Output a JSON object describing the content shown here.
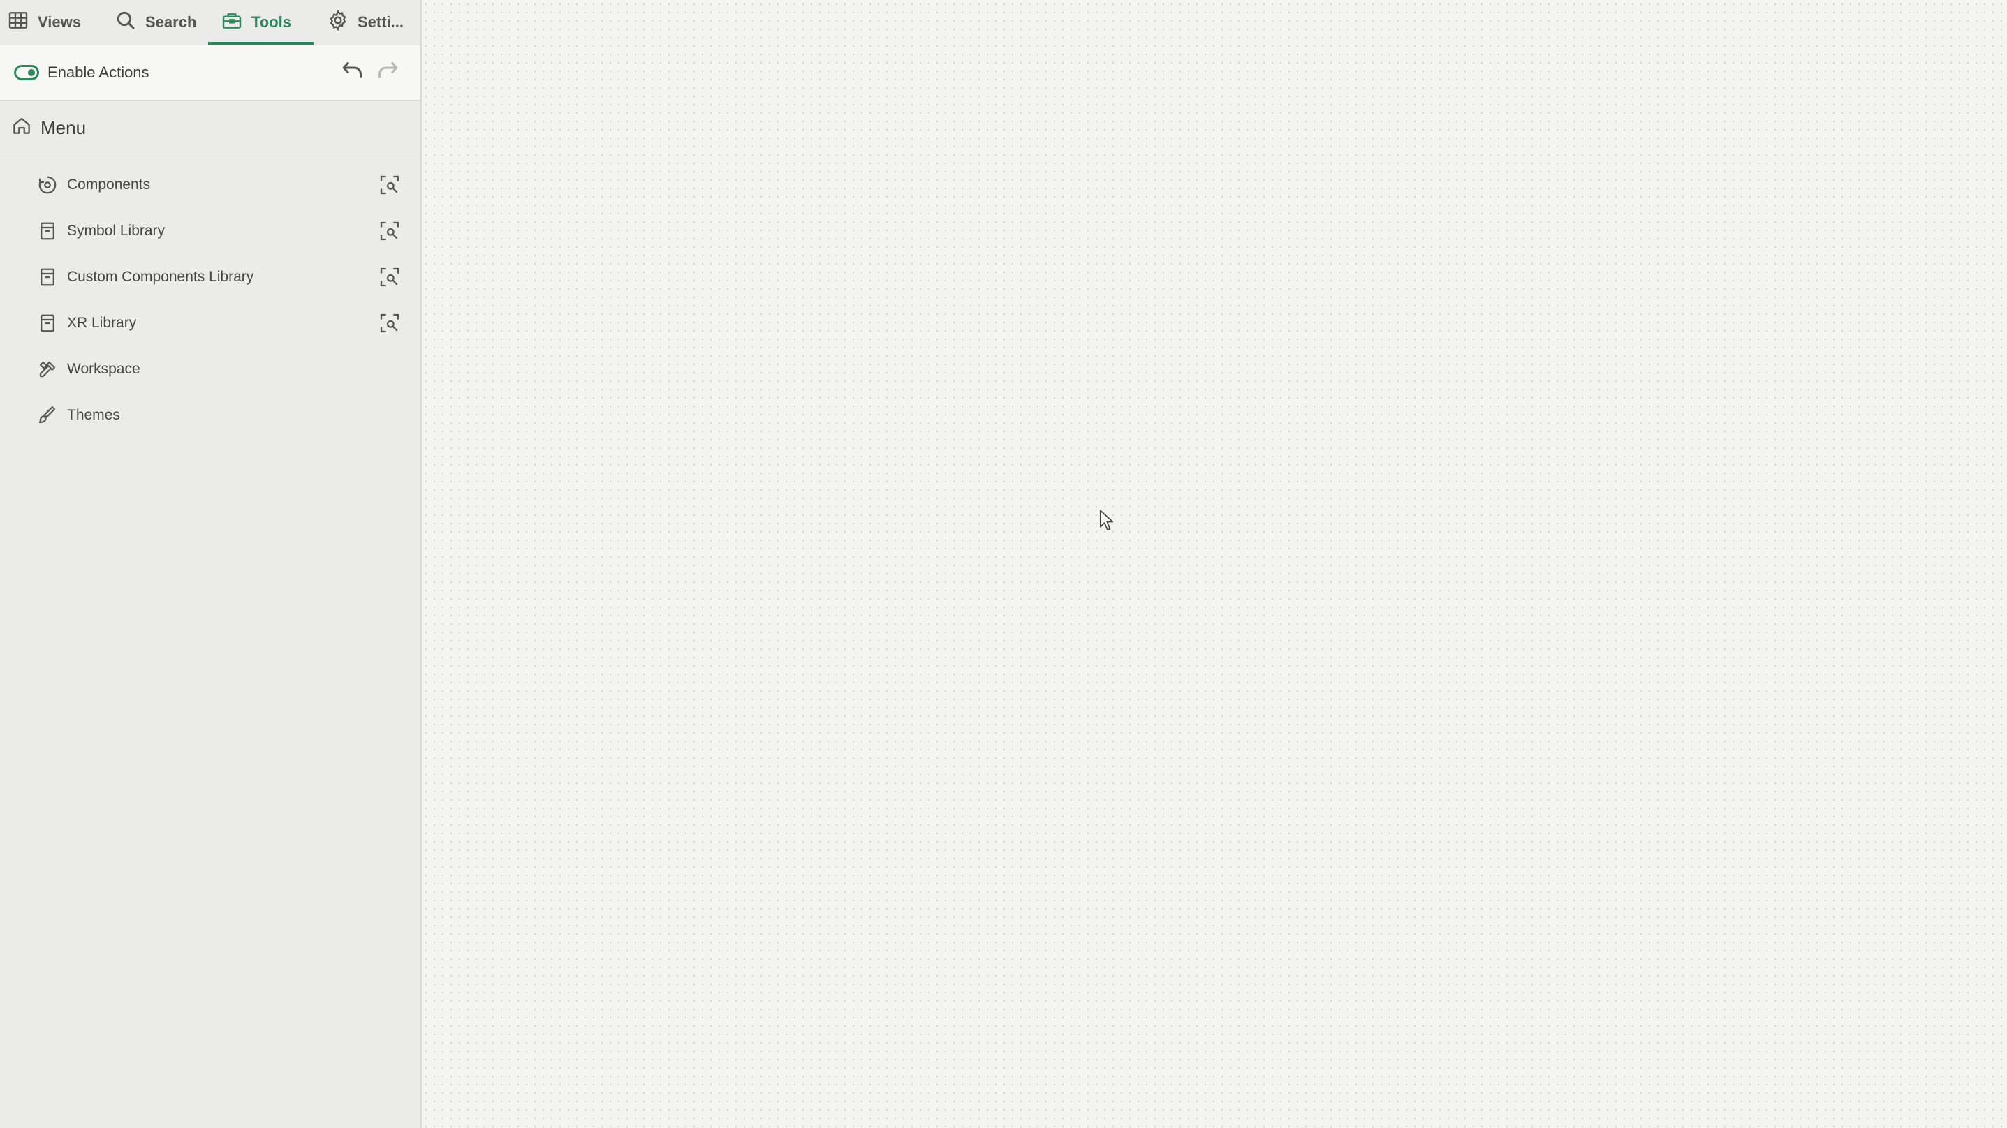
{
  "tabs": [
    {
      "label": "Views",
      "icon": "grid-icon"
    },
    {
      "label": "Search",
      "icon": "search-icon"
    },
    {
      "label": "Tools",
      "icon": "toolbox-icon",
      "active": true
    },
    {
      "label": "Setti...",
      "icon": "gear-icon"
    }
  ],
  "actions": {
    "toggle_label": "Enable Actions",
    "toggle_on": true
  },
  "menu": {
    "title": "Menu",
    "items": [
      {
        "label": "Components",
        "icon": "components-icon",
        "focusable": true
      },
      {
        "label": "Symbol Library",
        "icon": "library-icon",
        "focusable": true
      },
      {
        "label": "Custom Components Library",
        "icon": "library-icon",
        "focusable": true
      },
      {
        "label": "XR Library",
        "icon": "library-icon",
        "focusable": true
      },
      {
        "label": "Workspace",
        "icon": "tools-icon",
        "focusable": false
      },
      {
        "label": "Themes",
        "icon": "brush-icon",
        "focusable": false
      }
    ]
  },
  "colors": {
    "accent": "#2a8a5c",
    "sidebar_bg": "#ebebea",
    "canvas_bg": "#f4f4f2",
    "text": "#454545"
  }
}
